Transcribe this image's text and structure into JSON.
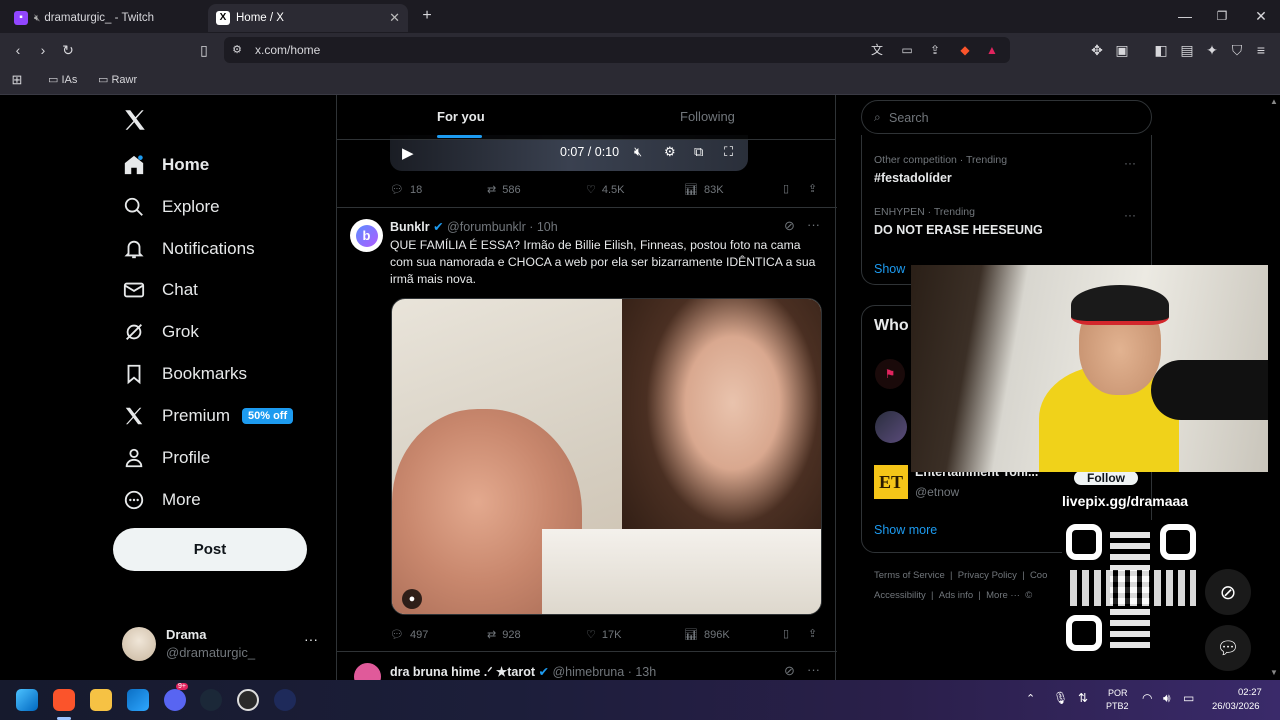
{
  "browser": {
    "tabs": [
      {
        "title": "dramaturgic_ - Twitch"
      },
      {
        "title": "Home / X"
      }
    ],
    "url": "x.com/home",
    "bookmarks": [
      "IAs",
      "Rawr"
    ]
  },
  "sidebar": {
    "items": [
      {
        "label": "Home"
      },
      {
        "label": "Explore"
      },
      {
        "label": "Notifications"
      },
      {
        "label": "Chat"
      },
      {
        "label": "Grok"
      },
      {
        "label": "Bookmarks"
      },
      {
        "label": "Premium"
      },
      {
        "label": "Profile"
      },
      {
        "label": "More"
      }
    ],
    "premium_badge": "50% off",
    "post_label": "Post",
    "account": {
      "name": "Drama",
      "handle": "@dramaturgic_"
    }
  },
  "timeline": {
    "tabs": [
      "For you",
      "Following"
    ],
    "video": {
      "time": "0:07 / 0:10"
    },
    "post1_stats": {
      "replies": "18",
      "reposts": "586",
      "likes": "4.5K",
      "views": "83K"
    },
    "post2": {
      "name": "Bunklr",
      "handle": "@forumbunklr",
      "time": "· 10h",
      "text": "QUE FAMÍLIA É ESSA? Irmão de Billie Eilish, Finneas, postou foto na cama com sua namorada e CHOCA a web por ela ser bizarramente IDÊNTICA a sua irmã mais nova.",
      "stats": {
        "replies": "497",
        "reposts": "928",
        "likes": "17K",
        "views": "896K"
      }
    },
    "post3": {
      "name": "dra bruna hime .ᐟ ★tarot",
      "handle": "@himebruna",
      "time": "· 13h"
    }
  },
  "right": {
    "search_placeholder": "Search",
    "trends": [
      {
        "category": "Other competition · Trending",
        "name": "#festadolíder"
      },
      {
        "category": "ENHYPEN · Trending",
        "name": "DO NOT ERASE HEESEUNG"
      }
    ],
    "show_more_1": "Show",
    "who_title": "Who",
    "who": [
      {
        "name": "Entertainment Toni...",
        "handle": "@etnow",
        "follow": "Follow"
      }
    ],
    "show_more_2": "Show more",
    "footer": [
      "Terms of Service",
      "|",
      "Privacy Policy",
      "|",
      "Coo",
      "Accessibility",
      "|",
      "Ads info",
      "|",
      "More ···",
      "©"
    ],
    "livepix": "livepix.gg/dramaaa"
  },
  "taskbar": {
    "lang": "POR",
    "lang2": "PTB2",
    "time": "02:27",
    "date": "26/03/2026",
    "discord_badge": "9+"
  }
}
